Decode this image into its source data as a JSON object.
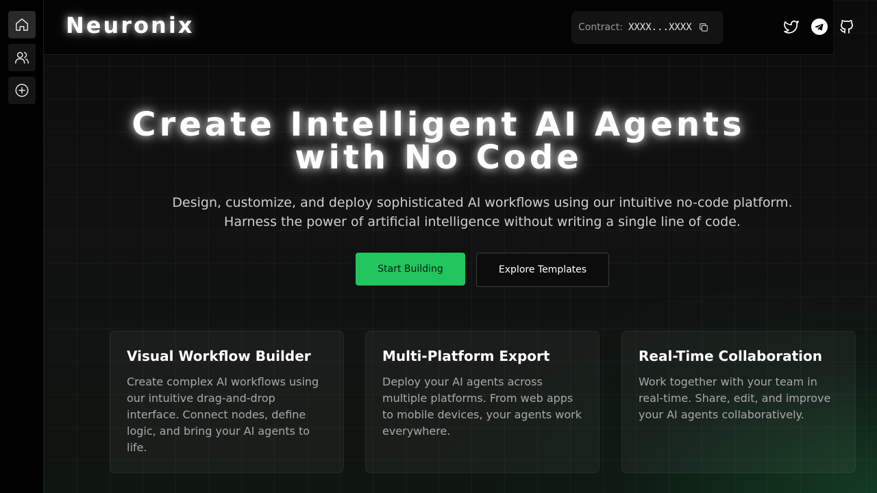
{
  "sidebar": {
    "items": [
      {
        "icon": "home-icon",
        "active": true
      },
      {
        "icon": "users-icon",
        "active": false
      },
      {
        "icon": "plus-circle-icon",
        "active": false
      }
    ]
  },
  "header": {
    "brand": "Neuronix",
    "contract_label": "Contract:",
    "contract_value": "XXXX...XXXX",
    "social": [
      "twitter-icon",
      "telegram-icon",
      "github-icon"
    ]
  },
  "hero": {
    "title_line1": "Create Intelligent AI Agents",
    "title_line2": "with No Code",
    "subtitle": "Design, customize, and deploy sophisticated AI workflows using our intuitive no-code platform. Harness the power of artificial intelligence without writing a single line of code.",
    "primary_button": "Start Building",
    "secondary_button": "Explore Templates"
  },
  "features": [
    {
      "title": "Visual Workflow Builder",
      "description": "Create complex AI workflows using our intuitive drag-and-drop interface. Connect nodes, define logic, and bring your AI agents to life."
    },
    {
      "title": "Multi-Platform Export",
      "description": "Deploy your AI agents across multiple platforms. From web apps to mobile devices, your agents work everywhere."
    },
    {
      "title": "Real-Time Collaboration",
      "description": "Work together with your team in real-time. Share, edit, and improve your AI agents collaboratively."
    }
  ],
  "colors": {
    "accent": "#22c55e",
    "background": "#000000",
    "glow_green": "#165a32"
  }
}
